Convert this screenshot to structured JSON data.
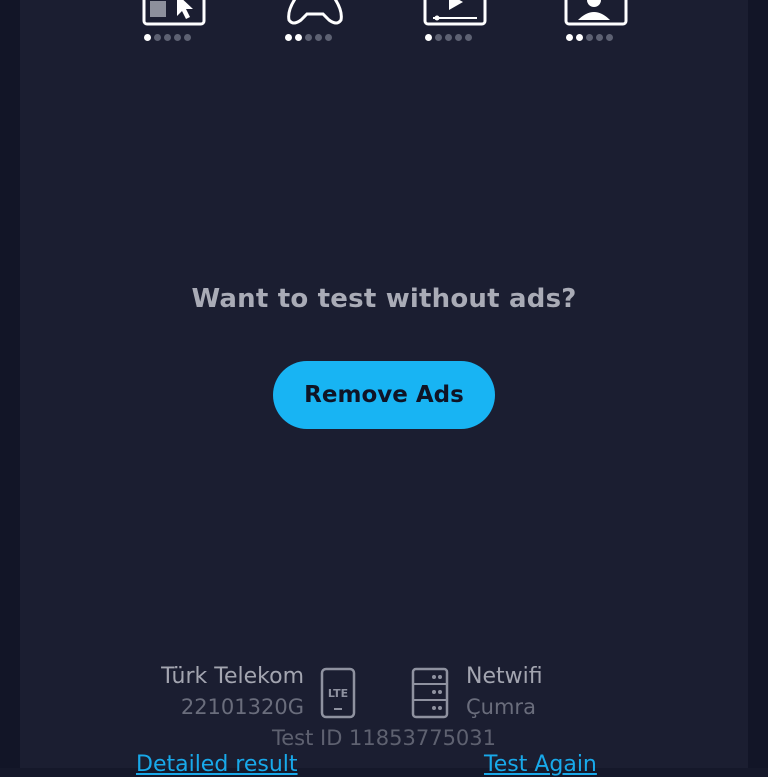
{
  "quality_icons": [
    {
      "icon": "browsing-cursor-icon",
      "rating": 1,
      "max": 5
    },
    {
      "icon": "gamepad-icon",
      "rating": 2,
      "max": 5
    },
    {
      "icon": "video-player-icon",
      "rating": 1,
      "max": 5
    },
    {
      "icon": "video-call-icon",
      "rating": 2,
      "max": 5
    }
  ],
  "ad_prompt": "Want to test without ads?",
  "remove_ads_label": "Remove Ads",
  "isp": {
    "name": "Türk Telekom",
    "code": "22101320G",
    "network_icon_text": "LTE"
  },
  "server": {
    "name": "Netwifi",
    "location": "Çumra"
  },
  "test_id": "Test ID 11853775031",
  "links": {
    "detailed": "Detailed result",
    "again": "Test Again"
  },
  "colors": {
    "background": "#1b1e31",
    "accent": "#18b4f3",
    "link": "#18a9ea"
  }
}
